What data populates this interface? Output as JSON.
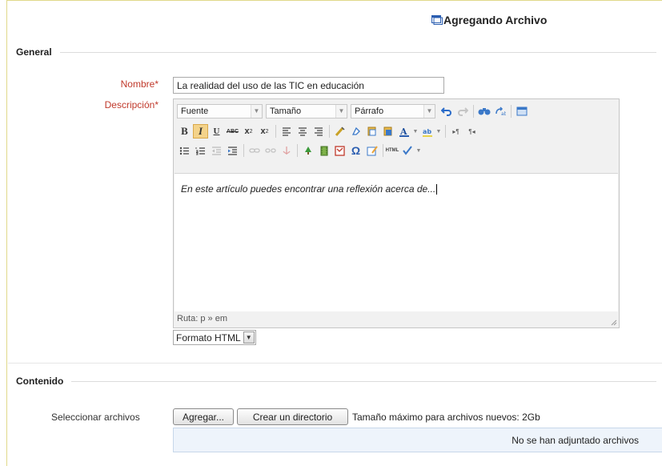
{
  "page": {
    "title": "Agregando Archivo",
    "title_icon": "window-icon"
  },
  "sections": {
    "general": "General",
    "contenido": "Contenido"
  },
  "fields": {
    "nombre_label": "Nombre",
    "nombre_value": "La realidad del uso de las TIC en educación",
    "descripcion_label": "Descripción",
    "required_marker": "*"
  },
  "editor": {
    "font_dropdown": "Fuente",
    "size_dropdown": "Tamaño",
    "paragraph_dropdown": "Párrafo",
    "content": "En este artículo puedes encontrar una reflexión acerca de...",
    "path": "Ruta: p » em",
    "toolbar_row1_icons": [
      "undo-icon",
      "redo-icon",
      "find-icon",
      "replace-icon",
      "fullscreen-icon"
    ],
    "toolbar_row2_icons": [
      "bold-icon",
      "italic-icon",
      "underline-icon",
      "strikethrough-icon",
      "subscript-icon",
      "superscript-icon",
      "align-left-icon",
      "align-center-icon",
      "align-right-icon",
      "cleanup-icon",
      "remove-format-icon",
      "paste-text-icon",
      "paste-word-icon",
      "text-color-icon",
      "highlight-icon",
      "ltr-icon",
      "rtl-icon"
    ],
    "toolbar_row3_icons": [
      "bullet-list-icon",
      "numbered-list-icon",
      "outdent-icon",
      "indent-icon",
      "link-icon",
      "unlink-icon",
      "anchor-icon",
      "image-icon",
      "media-icon",
      "emoticon-icon",
      "special-char-icon",
      "table-icon",
      "html-icon",
      "spellcheck-icon"
    ]
  },
  "format": {
    "selected": "Formato HTML"
  },
  "files": {
    "select_label": "Seleccionar archivos",
    "add_button": "Agregar...",
    "create_dir_button": "Crear un directorio",
    "max_size": "Tamaño máximo para archivos nuevos: 2Gb",
    "empty_message": "No se han adjuntado archivos"
  },
  "colors": {
    "required_label": "#c0392b",
    "files_box_bg": "#eef4fb",
    "frame_accent": "#e0d98a"
  }
}
